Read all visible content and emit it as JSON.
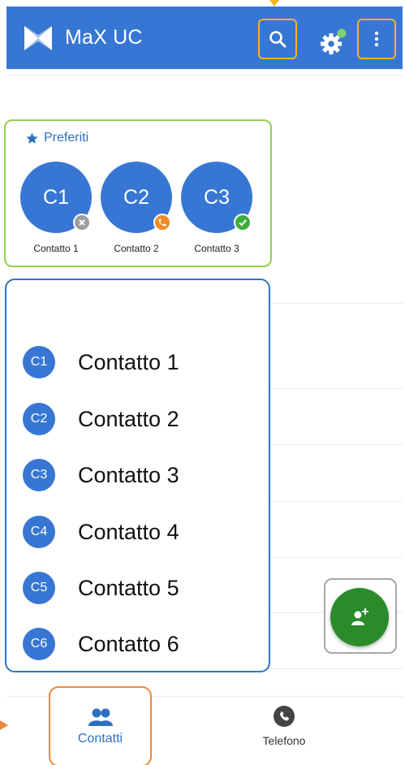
{
  "app": {
    "title": "MaX UC",
    "brand_color": "#3777d3"
  },
  "header": {
    "search_icon": "search-icon",
    "settings_icon": "gear-icon",
    "settings_status_color": "#7ed167",
    "menu_icon": "more-vert-icon"
  },
  "favorites": {
    "title": "Preferiti",
    "icon": "star-icon",
    "items": [
      {
        "initials": "C1",
        "name": "Contatto 1",
        "status": "offline",
        "status_color": "#9e9e9e",
        "status_icon": "close-icon"
      },
      {
        "initials": "C2",
        "name": "Contatto 2",
        "status": "on-call",
        "status_color": "#f08a24",
        "status_icon": "phone-icon"
      },
      {
        "initials": "C3",
        "name": "Contatto 3",
        "status": "available",
        "status_color": "#3fae3f",
        "status_icon": "check-icon"
      }
    ]
  },
  "contacts": {
    "items": [
      {
        "initials": "C1",
        "name": "Contatto 1"
      },
      {
        "initials": "C2",
        "name": "Contatto 2"
      },
      {
        "initials": "C3",
        "name": "Contatto 3"
      },
      {
        "initials": "C4",
        "name": "Contatto 4"
      },
      {
        "initials": "C5",
        "name": "Contatto 5"
      },
      {
        "initials": "C6",
        "name": "Contatto 6"
      }
    ]
  },
  "fab": {
    "icon": "add-contact-icon",
    "color": "#2a8b2a"
  },
  "bottom_nav": {
    "tabs": [
      {
        "label": "Contatti",
        "icon": "people-icon",
        "active": true,
        "color": "#2f6fc1"
      },
      {
        "label": "Telefono",
        "icon": "phone-icon",
        "active": false,
        "color": "#444444"
      }
    ]
  }
}
